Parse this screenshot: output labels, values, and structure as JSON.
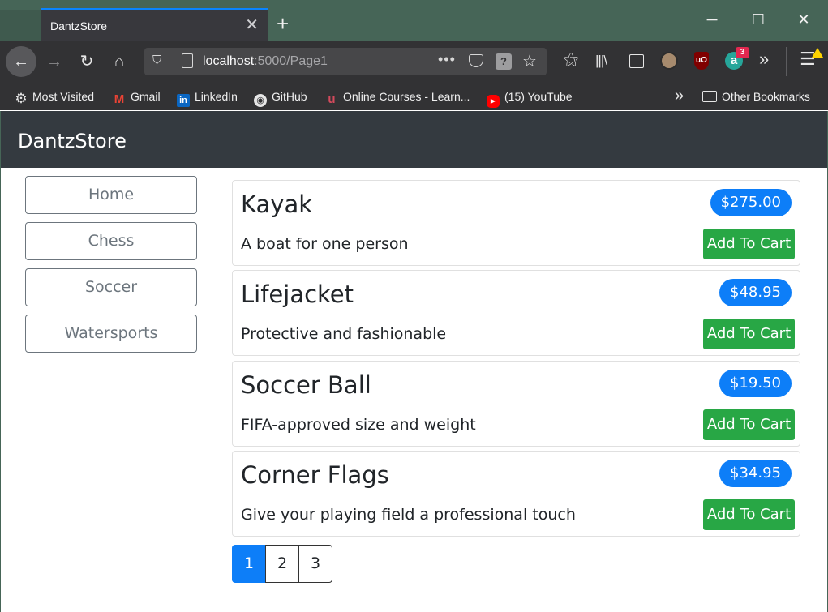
{
  "browser": {
    "tab_title": "DantzStore",
    "tab_close": "✕",
    "new_tab": "+",
    "window_controls": {
      "minimize": "─",
      "maximize": "☐",
      "close": "✕"
    },
    "nav": {
      "back": "←",
      "forward": "→",
      "reload": "↻",
      "home": "⌂"
    },
    "url": {
      "host": "localhost",
      "rest": ":5000/Page1"
    },
    "extension_badge": "3",
    "bookmarks": [
      {
        "label": "Most Visited",
        "icon": "gear-icon",
        "glyph": "⚙"
      },
      {
        "label": "Gmail",
        "icon": "gmail-icon",
        "glyph": "M"
      },
      {
        "label": "LinkedIn",
        "icon": "linkedin-icon",
        "glyph": "in"
      },
      {
        "label": "GitHub",
        "icon": "github-icon",
        "glyph": "◉"
      },
      {
        "label": "Online Courses - Learn...",
        "icon": "courses-icon",
        "glyph": "u"
      },
      {
        "label": "(15) YouTube",
        "icon": "youtube-icon",
        "glyph": "▶"
      }
    ],
    "other_bookmarks": "Other Bookmarks"
  },
  "store": {
    "brand": "DantzStore",
    "categories": [
      "Home",
      "Chess",
      "Soccer",
      "Watersports"
    ],
    "products": [
      {
        "name": "Kayak",
        "price": "$275.00",
        "description": "A boat for one person",
        "cart_label": "Add To Cart"
      },
      {
        "name": "Lifejacket",
        "price": "$48.95",
        "description": "Protective and fashionable",
        "cart_label": "Add To Cart"
      },
      {
        "name": "Soccer Ball",
        "price": "$19.50",
        "description": "FIFA-approved size and weight",
        "cart_label": "Add To Cart"
      },
      {
        "name": "Corner Flags",
        "price": "$34.95",
        "description": "Give your playing field a professional touch",
        "cart_label": "Add To Cart"
      }
    ],
    "pagination": {
      "pages": [
        "1",
        "2",
        "3"
      ],
      "active": "1"
    }
  },
  "colors": {
    "header_bg": "#343a40",
    "price_badge": "#0d7ef8",
    "cart_button": "#28a745",
    "category_border": "#6c757d",
    "page_active": "#0d7ef8"
  }
}
